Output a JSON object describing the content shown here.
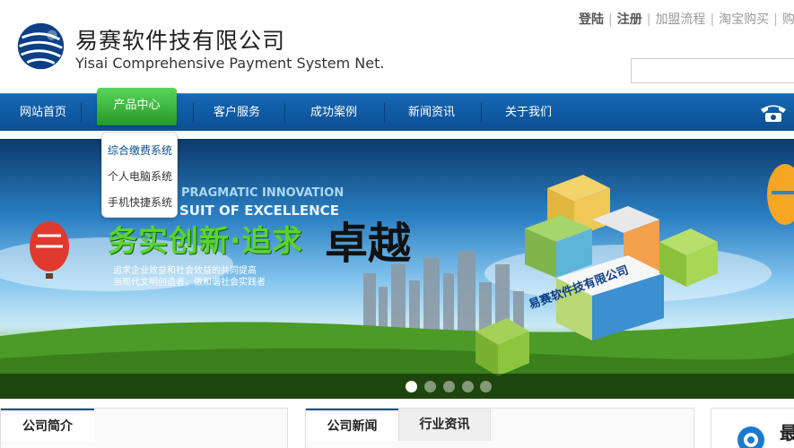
{
  "brand": {
    "name_cn": "易赛软件技有限公司",
    "name_en": "Yisai Comprehensive Payment System Net."
  },
  "toplinks": [
    {
      "label": "登陆",
      "strong": true
    },
    {
      "label": "注册",
      "strong": true
    },
    {
      "label": "加盟流程",
      "strong": false
    },
    {
      "label": "淘宝购买",
      "strong": false
    },
    {
      "label": "购",
      "strong": false
    }
  ],
  "search": {
    "value": ""
  },
  "nav": {
    "items": [
      {
        "label": "网站首页"
      },
      {
        "label": "产品中心"
      },
      {
        "label": "客户服务"
      },
      {
        "label": "成功案例"
      },
      {
        "label": "新闻资讯"
      },
      {
        "label": "关于我们"
      }
    ],
    "active_index": 1
  },
  "dropdown": {
    "items": [
      "综合缴费系统",
      "个人电脑系统",
      "手机快捷系统"
    ]
  },
  "banner": {
    "slogan_en_1": "PRAGMATIC INNOVATION",
    "slogan_en_2": "SUIT OF EXCELLENCE",
    "slogan_cn": "务实创新·追求",
    "slogan_cn_2": "卓越",
    "sub_1": "追求企业效益和社会效益的共同提高",
    "sub_2": "当现代文明创造者，做和谐社会实践者",
    "cube_label": "易赛软件技有限公司",
    "slide_count": 5,
    "active_slide": 0
  },
  "panels": {
    "about_title": "公司简介",
    "news_tabs": [
      "公司新闻",
      "行业资讯"
    ],
    "right_partial": "最"
  },
  "colors": {
    "nav_blue": "#0b4f94",
    "active_green": "#2ea52f",
    "slogan_green": "#5ad52b"
  }
}
